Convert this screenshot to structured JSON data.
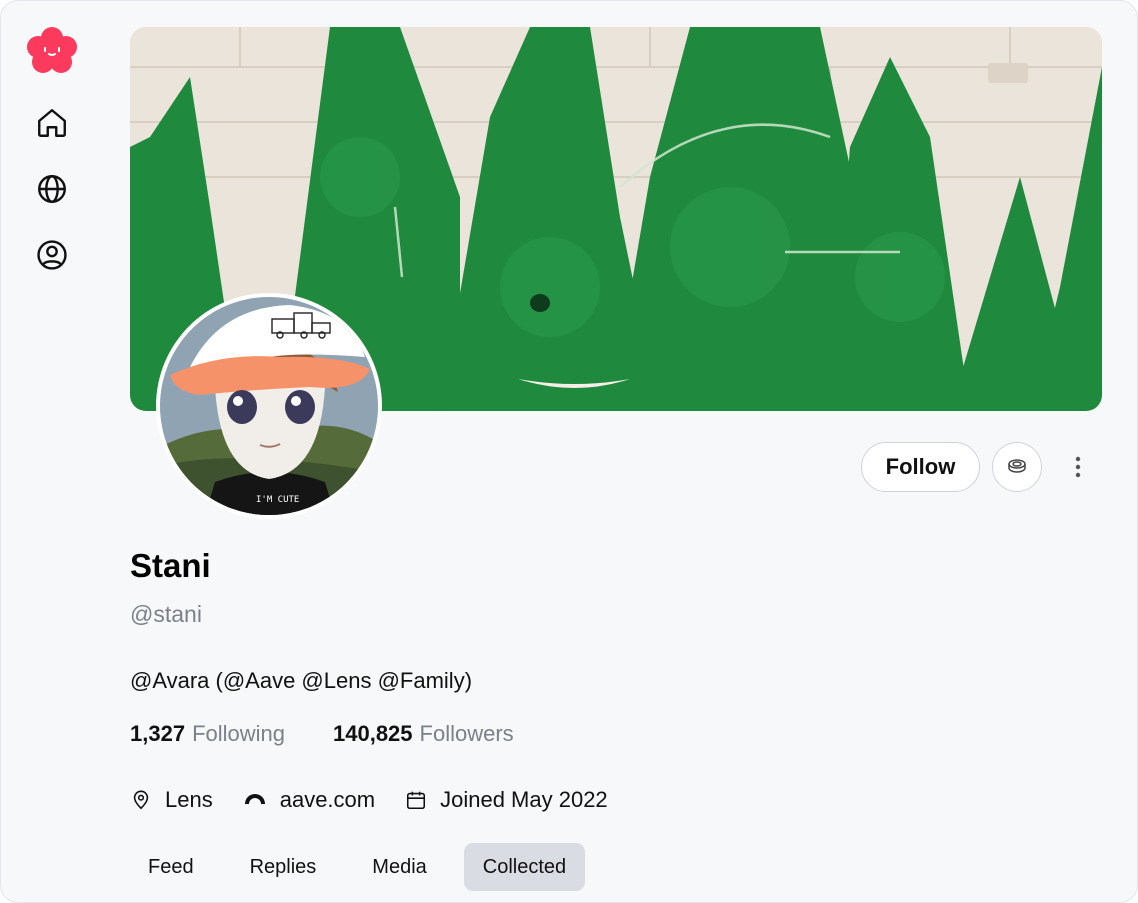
{
  "sidebar": {
    "logo_icon": "lens-flower-logo-icon",
    "items": [
      {
        "icon": "home-icon"
      },
      {
        "icon": "globe-icon"
      },
      {
        "icon": "user-circle-icon"
      }
    ]
  },
  "profile": {
    "name": "Stani",
    "handle": "@stani",
    "bio": "@Avara (@Aave @Lens @Family)",
    "avatar_cap_text": "I'M CUTE"
  },
  "actions": {
    "follow_label": "Follow",
    "collect_icon": "coins-icon",
    "more_icon": "more-vertical-icon"
  },
  "stats": {
    "following_count": "1,327",
    "following_label": "Following",
    "followers_count": "140,825",
    "followers_label": "Followers"
  },
  "meta": {
    "location": "Lens",
    "website": "aave.com",
    "joined": "Joined May 2022"
  },
  "tabs": [
    {
      "label": "Feed",
      "active": false
    },
    {
      "label": "Replies",
      "active": false
    },
    {
      "label": "Media",
      "active": false
    },
    {
      "label": "Collected",
      "active": true
    }
  ],
  "colors": {
    "background": "#f7f8fa",
    "logo_pink": "#fb3a5d",
    "banner_green": "#1f8a3e",
    "banner_wall": "#e9e2d8",
    "muted_text": "#7b8089",
    "active_tab": "#d9dce2"
  }
}
